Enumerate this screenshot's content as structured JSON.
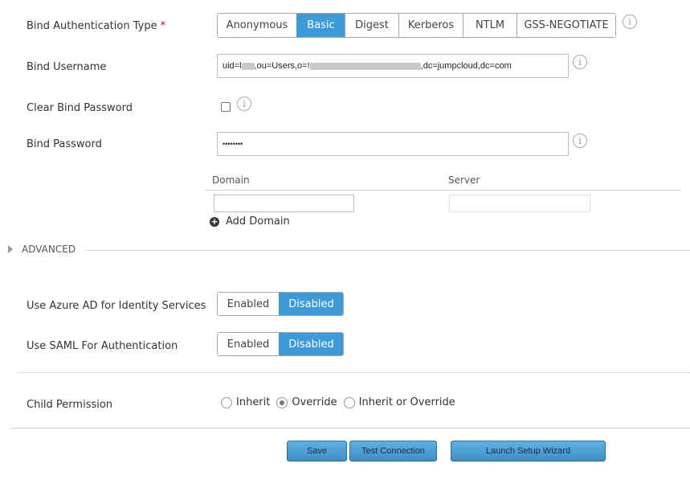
{
  "form": {
    "bind_auth_type": {
      "label": "Bind Authentication Type",
      "required_mark": "*",
      "options": [
        "Anonymous",
        "Basic",
        "Digest",
        "Kerberos",
        "NTLM",
        "GSS-NEGOTIATE"
      ],
      "selected": "Basic"
    },
    "bind_username": {
      "label": "Bind Username",
      "value_prefix": "uid=l",
      "value_mid": ",ou=Users,o=!",
      "value_suffix": ",dc=jumpcloud,dc=com"
    },
    "clear_bind_password": {
      "label": "Clear Bind Password",
      "checked": false
    },
    "bind_password": {
      "label": "Bind Password",
      "value": "••••••••"
    },
    "domains": {
      "col_domain": "Domain",
      "col_server": "Server",
      "add_label": "Add Domain"
    },
    "advanced_label": "ADVANCED",
    "azure_ad": {
      "label": "Use Azure AD for Identity Services",
      "enabled_label": "Enabled",
      "disabled_label": "Disabled",
      "selected": "Disabled"
    },
    "saml": {
      "label": "Use SAML For Authentication",
      "enabled_label": "Enabled",
      "disabled_label": "Disabled",
      "selected": "Disabled"
    },
    "child_permission": {
      "label": "Child Permission",
      "options": [
        "Inherit",
        "Override",
        "Inherit or Override"
      ],
      "selected": "Override"
    }
  },
  "buttons": {
    "save": "Save",
    "test": "Test Connection",
    "wizard": "Launch Setup Wizard"
  },
  "colors": {
    "accent": "#3e9ad6",
    "required": "#d0021b"
  },
  "icons": {
    "info": "info-icon",
    "add": "plus-circle-icon",
    "expand": "triangle-right-icon"
  }
}
